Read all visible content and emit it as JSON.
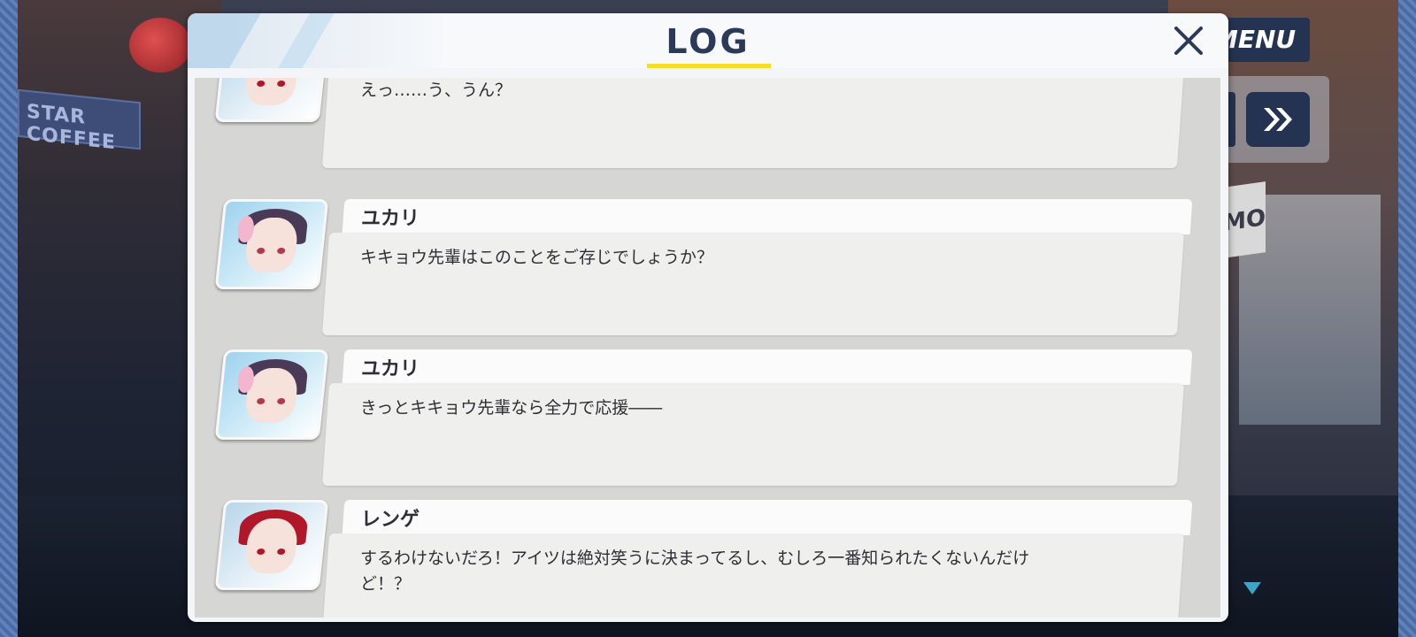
{
  "background": {
    "left_sign": "STAR COFFEE",
    "right_sign": "OMO"
  },
  "hud": {
    "menu_label": "MENU",
    "skip_icon": "double-chevron-right-icon"
  },
  "log": {
    "title": "LOG",
    "close_icon": "close-icon",
    "entries": [
      {
        "speaker": "",
        "avatar": "renge",
        "text": "えっ……う、うん？"
      },
      {
        "speaker": "ユカリ",
        "avatar": "yukari",
        "text": "キキョウ先輩はこのことをご存じでしょうか？"
      },
      {
        "speaker": "ユカリ",
        "avatar": "yukari",
        "text": "きっとキキョウ先輩なら全力で応援――"
      },
      {
        "speaker": "レンゲ",
        "avatar": "renge",
        "text": "するわけないだろ！アイツは絶対笑うに決まってるし、むしろ一番知られたくないんだけど！？"
      }
    ]
  },
  "colors": {
    "accent_yellow": "#f5dd2a",
    "title_navy": "#2b3a58",
    "hud_navy": "#243352"
  }
}
